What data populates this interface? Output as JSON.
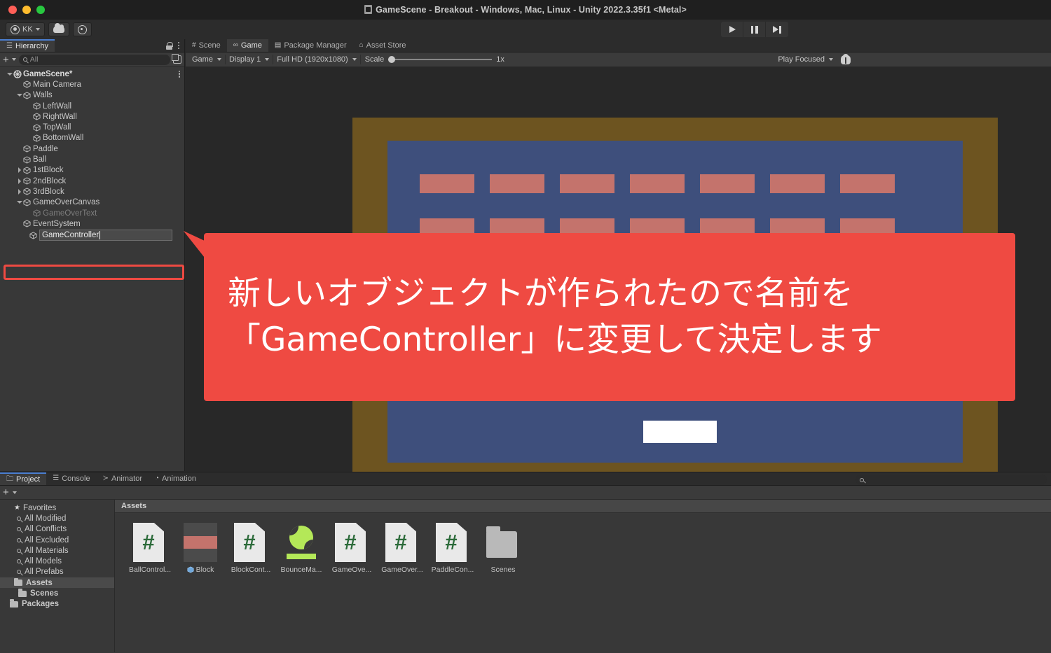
{
  "window": {
    "title": "GameScene - Breakout - Windows, Mac, Linux - Unity 2022.3.35f1 <Metal>",
    "traffic_colors": {
      "close": "#ff5f57",
      "minimize": "#febc2e",
      "zoom": "#28c840"
    }
  },
  "toolbar": {
    "account_label": "KK",
    "cloud_icon": "cloud-icon",
    "settings_icon": "gear-icon",
    "play_label": "play-icon",
    "pause_label": "pause-icon",
    "step_label": "step-icon"
  },
  "hierarchy": {
    "tab_label": "Hierarchy",
    "tab_icon": "hierarchy-icon",
    "lock_icon": "lock-icon",
    "menu_icon": "kebab-menu-icon",
    "add_label": "+",
    "search_placeholder": "All",
    "tree": [
      {
        "label": "GameScene*",
        "depth": 0,
        "fold": "down",
        "kind": "scene"
      },
      {
        "label": "Main Camera",
        "depth": 1,
        "fold": "none",
        "kind": "object"
      },
      {
        "label": "Walls",
        "depth": 1,
        "fold": "down",
        "kind": "object"
      },
      {
        "label": "LeftWall",
        "depth": 2,
        "fold": "none",
        "kind": "object"
      },
      {
        "label": "RightWall",
        "depth": 2,
        "fold": "none",
        "kind": "object"
      },
      {
        "label": "TopWall",
        "depth": 2,
        "fold": "none",
        "kind": "object"
      },
      {
        "label": "BottomWall",
        "depth": 2,
        "fold": "none",
        "kind": "object"
      },
      {
        "label": "Paddle",
        "depth": 1,
        "fold": "none",
        "kind": "object"
      },
      {
        "label": "Ball",
        "depth": 1,
        "fold": "none",
        "kind": "object"
      },
      {
        "label": "1stBlock",
        "depth": 1,
        "fold": "right",
        "kind": "object"
      },
      {
        "label": "2ndBlock",
        "depth": 1,
        "fold": "right",
        "kind": "object"
      },
      {
        "label": "3rdBlock",
        "depth": 1,
        "fold": "right",
        "kind": "object"
      },
      {
        "label": "GameOverCanvas",
        "depth": 1,
        "fold": "down",
        "kind": "object"
      },
      {
        "label": "GameOverText",
        "depth": 2,
        "fold": "none",
        "kind": "disabled"
      },
      {
        "label": "EventSystem",
        "depth": 1,
        "fold": "none",
        "kind": "object"
      }
    ],
    "rename_value": "GameController",
    "highlight_color": "#ef4a42"
  },
  "gameview": {
    "tabs": [
      {
        "label": "Scene",
        "icon": "grid-icon",
        "active": false
      },
      {
        "label": "Game",
        "icon": "gamepad-icon",
        "active": true
      },
      {
        "label": "Package Manager",
        "icon": "package-icon",
        "active": false
      },
      {
        "label": "Asset Store",
        "icon": "store-icon",
        "active": false
      }
    ],
    "target_display_label": "Game",
    "display_label": "Display 1",
    "resolution_label": "Full HD (1920x1080)",
    "scale_label": "Scale",
    "scale_value": "1x",
    "play_mode_label": "Play Focused",
    "stats_icon": "bug-icon"
  },
  "game_scene": {
    "border_color": "#6d5420",
    "field_color": "#3e4f7c",
    "brick_color": "#c4736c",
    "paddle_color": "#ffffff",
    "ball_color": "#ffffff",
    "brick_columns": 7,
    "brick_rows": 3
  },
  "callout": {
    "background": "#ef4a42",
    "text_color": "#ffffff",
    "line1": "新しいオブジェクトが作られたので名前を",
    "line2": "「GameController」に変更して決定します"
  },
  "project": {
    "tabs": [
      {
        "label": "Project",
        "icon": "folder-icon",
        "active": true
      },
      {
        "label": "Console",
        "icon": "console-icon",
        "active": false
      },
      {
        "label": "Animator",
        "icon": "animator-icon",
        "active": false
      },
      {
        "label": "Animation",
        "icon": "clock-icon",
        "active": false
      }
    ],
    "add_label": "+",
    "search_placeholder": "",
    "sidebar": [
      {
        "label": "Favorites",
        "kind": "favorites-root",
        "fold": "down"
      },
      {
        "label": "All Modified",
        "kind": "saved-search"
      },
      {
        "label": "All Conflicts",
        "kind": "saved-search"
      },
      {
        "label": "All Excluded",
        "kind": "saved-search"
      },
      {
        "label": "All Materials",
        "kind": "saved-search"
      },
      {
        "label": "All Models",
        "kind": "saved-search"
      },
      {
        "label": "All Prefabs",
        "kind": "saved-search"
      },
      {
        "label": "Assets",
        "kind": "folder",
        "fold": "down",
        "selected": true
      },
      {
        "label": "Scenes",
        "kind": "folder"
      },
      {
        "label": "Packages",
        "kind": "folder"
      }
    ],
    "assets_header": "Assets",
    "assets": [
      {
        "label": "BallControl...",
        "kind": "script"
      },
      {
        "label": "Block",
        "kind": "prefab"
      },
      {
        "label": "BlockCont...",
        "kind": "script"
      },
      {
        "label": "BounceMa...",
        "kind": "material"
      },
      {
        "label": "GameOve...",
        "kind": "script"
      },
      {
        "label": "GameOver...",
        "kind": "script"
      },
      {
        "label": "PaddleCon...",
        "kind": "script"
      },
      {
        "label": "Scenes",
        "kind": "folder"
      }
    ]
  }
}
